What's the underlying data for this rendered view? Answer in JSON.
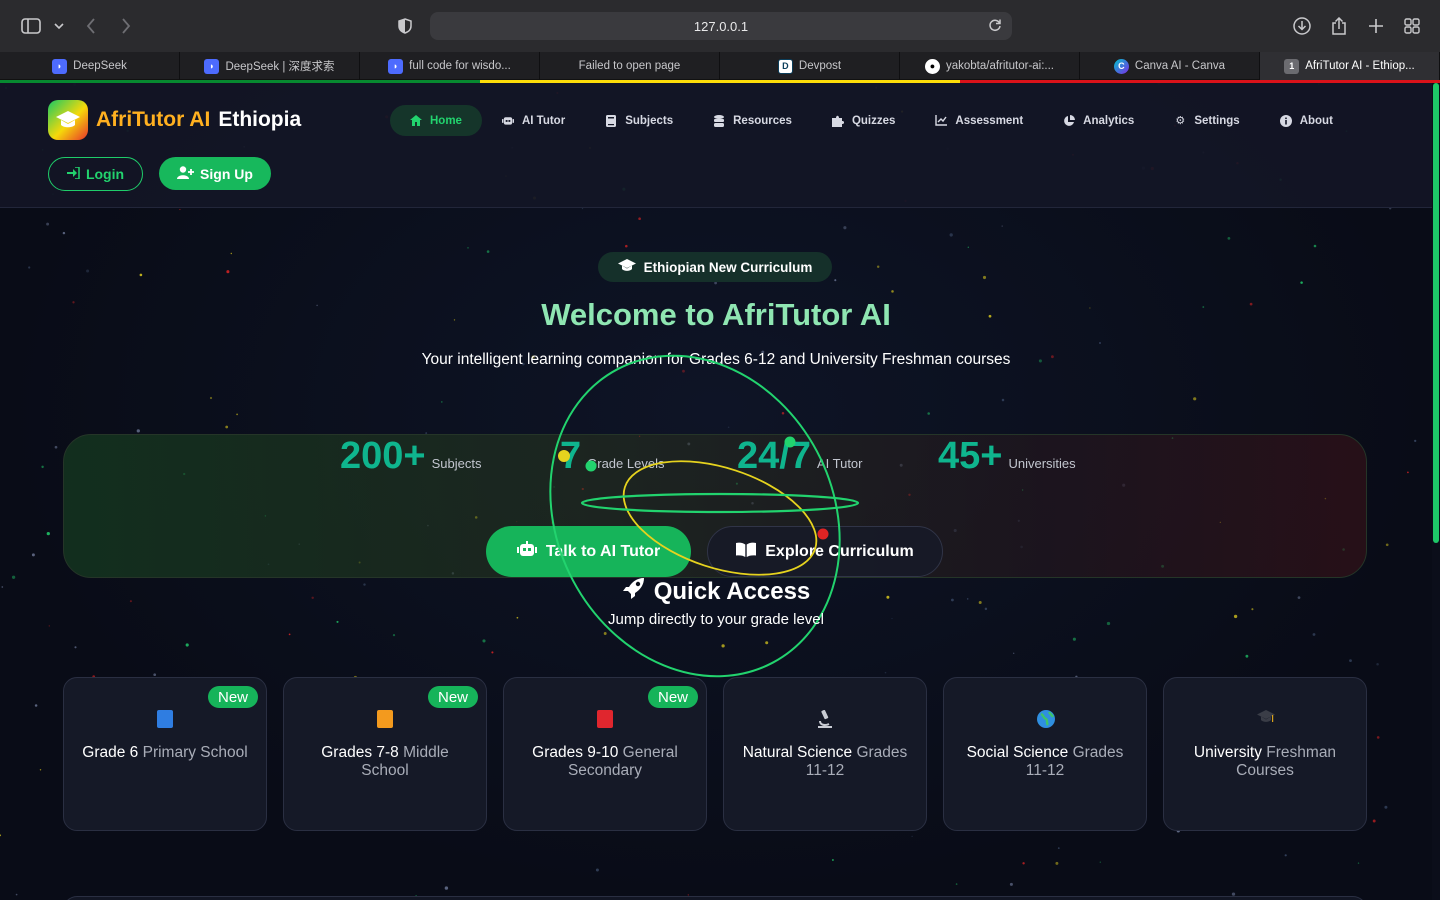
{
  "browser": {
    "url": "127.0.0.1",
    "tabs": [
      {
        "label": "DeepSeek",
        "icon": "deepseek-icon",
        "color": "#4d6bfe"
      },
      {
        "label": "DeepSeek | 深度求索",
        "icon": "deepseek-icon",
        "color": "#4d6bfe"
      },
      {
        "label": "full code for wisdo...",
        "icon": "deepseek-icon",
        "color": "#4d6bfe"
      },
      {
        "label": "Failed to open page",
        "icon": "",
        "color": ""
      },
      {
        "label": "Devpost",
        "icon": "devpost-icon",
        "color": "#ffffff"
      },
      {
        "label": "yakobta/afritutor-ai:...",
        "icon": "github-icon",
        "color": "#ffffff"
      },
      {
        "label": "Canva AI - Canva",
        "icon": "canva-icon",
        "color": "#7d2ae8"
      },
      {
        "label": "AfriTutor AI - Ethiop...",
        "icon": "tab-number-icon",
        "color": "#6b6b70",
        "badge": "1"
      }
    ]
  },
  "header": {
    "brand_a": "AfriTutor AI",
    "brand_b": "Ethiopia",
    "nav": [
      {
        "label": "Home",
        "icon": "home-icon"
      },
      {
        "label": "AI Tutor",
        "icon": "robot-icon"
      },
      {
        "label": "Subjects",
        "icon": "book-icon"
      },
      {
        "label": "Resources",
        "icon": "database-icon"
      },
      {
        "label": "Quizzes",
        "icon": "puzzle-icon"
      },
      {
        "label": "Assessment",
        "icon": "chart-line-icon"
      },
      {
        "label": "Analytics",
        "icon": "pie-chart-icon"
      },
      {
        "label": "Settings",
        "icon": "gear-icon"
      },
      {
        "label": "About",
        "icon": "info-icon"
      }
    ],
    "login": "Login",
    "signup": "Sign Up"
  },
  "hero": {
    "badge": "Ethiopian New Curriculum",
    "title": "Welcome to AfriTutor AI",
    "subtitle": "Your intelligent learning companion for Grades 6-12 and University Freshman courses",
    "stats": [
      {
        "value": "200+",
        "label": "Subjects"
      },
      {
        "value": "7",
        "label": "Grade Levels"
      },
      {
        "value": "24/7",
        "label": "AI Tutor"
      },
      {
        "value": "45+",
        "label": "Universities"
      }
    ],
    "talk_button": "Talk to AI Tutor",
    "explore_button": "Explore Curriculum"
  },
  "quick_access": {
    "title": "Quick Access",
    "subtitle": "Jump directly to your grade level",
    "cards": [
      {
        "main": "Grade 6",
        "sub": "Primary School",
        "new": "New",
        "icon": "blue-book-icon",
        "color": "#2f7de1"
      },
      {
        "main": "Grades 7-8",
        "sub": "Middle School",
        "new": "New",
        "icon": "orange-book-icon",
        "color": "#f39a1e"
      },
      {
        "main": "Grades 9-10",
        "sub": "General Secondary",
        "new": "New",
        "icon": "red-book-icon",
        "color": "#e0262e"
      },
      {
        "main": "Natural Science",
        "sub": "Grades 11-12",
        "new": "",
        "icon": "microscope-icon",
        "color": "#c9ccd4"
      },
      {
        "main": "Social Science",
        "sub": "Grades 11-12",
        "new": "",
        "icon": "globe-icon",
        "color": "#2f8fe0"
      },
      {
        "main": "University",
        "sub": "Freshman Courses",
        "new": "",
        "icon": "graduation-cap-icon",
        "color": "#3a3d47"
      }
    ]
  },
  "colors": {
    "accent_green": "#17b85c",
    "stat_teal": "#0fb58e",
    "title_green": "#8fe6b2",
    "flag_green": "#078930",
    "flag_yellow": "#fcdd09",
    "flag_red": "#da121a"
  }
}
